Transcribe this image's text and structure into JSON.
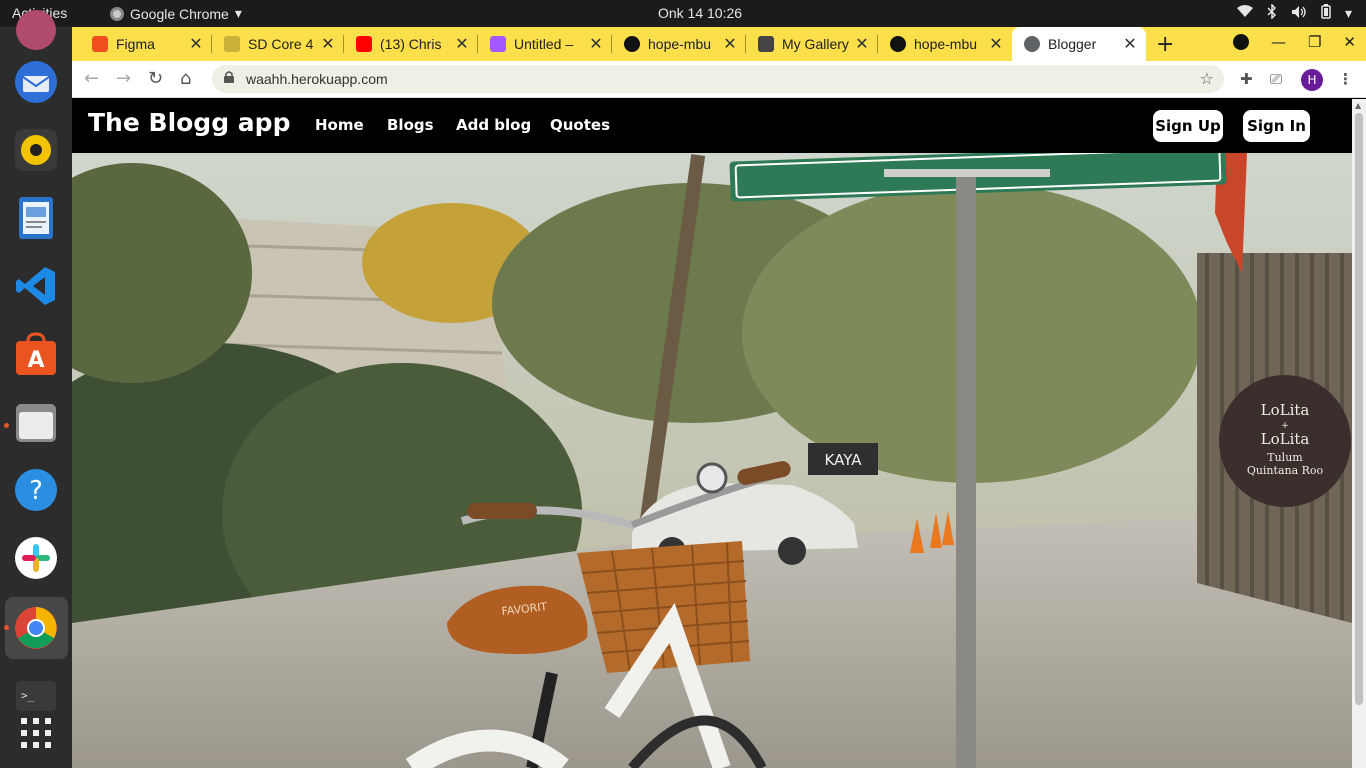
{
  "system": {
    "activities": "Activities",
    "app_name": "Google Chrome",
    "clock": "Onk 14  10:26"
  },
  "tabs": [
    {
      "title": "Figma",
      "fav_color": "#f24e1e"
    },
    {
      "title": "SD Core 4",
      "fav_color": "#c9b037"
    },
    {
      "title": "(13) Chris",
      "fav_color": "#ff0000"
    },
    {
      "title": "Untitled –",
      "fav_color": "#a259ff"
    },
    {
      "title": "hope-mbu",
      "fav_color": "#111111"
    },
    {
      "title": "My Gallery",
      "fav_color": "#444444"
    },
    {
      "title": "hope-mbu",
      "fav_color": "#111111"
    },
    {
      "title": "Blogger",
      "fav_color": "#5f6368"
    }
  ],
  "active_tab_index": 7,
  "address_bar": {
    "url": "waahh.herokuapp.com"
  },
  "profile": {
    "initial": "H",
    "color": "#6a1b9a"
  },
  "site": {
    "brand": "The Blogg app",
    "nav": [
      "Home",
      "Blogs",
      "Add blog",
      "Quotes"
    ],
    "sign_up": "Sign Up",
    "sign_in": "Sign In"
  },
  "hero": {
    "sign_text": "LoLita + LoLita Tulum Quintana Roo",
    "sign_lines": [
      "LoLita",
      "+",
      "LoLita",
      "Tulum",
      "Quintana Roo"
    ],
    "shop_sign": "KAYA",
    "seat_brand": "FAVORIT"
  },
  "colors": {
    "tabstrip": "#fbe04b",
    "navbar": "#000000",
    "accent_profile": "#6a1b9a"
  }
}
